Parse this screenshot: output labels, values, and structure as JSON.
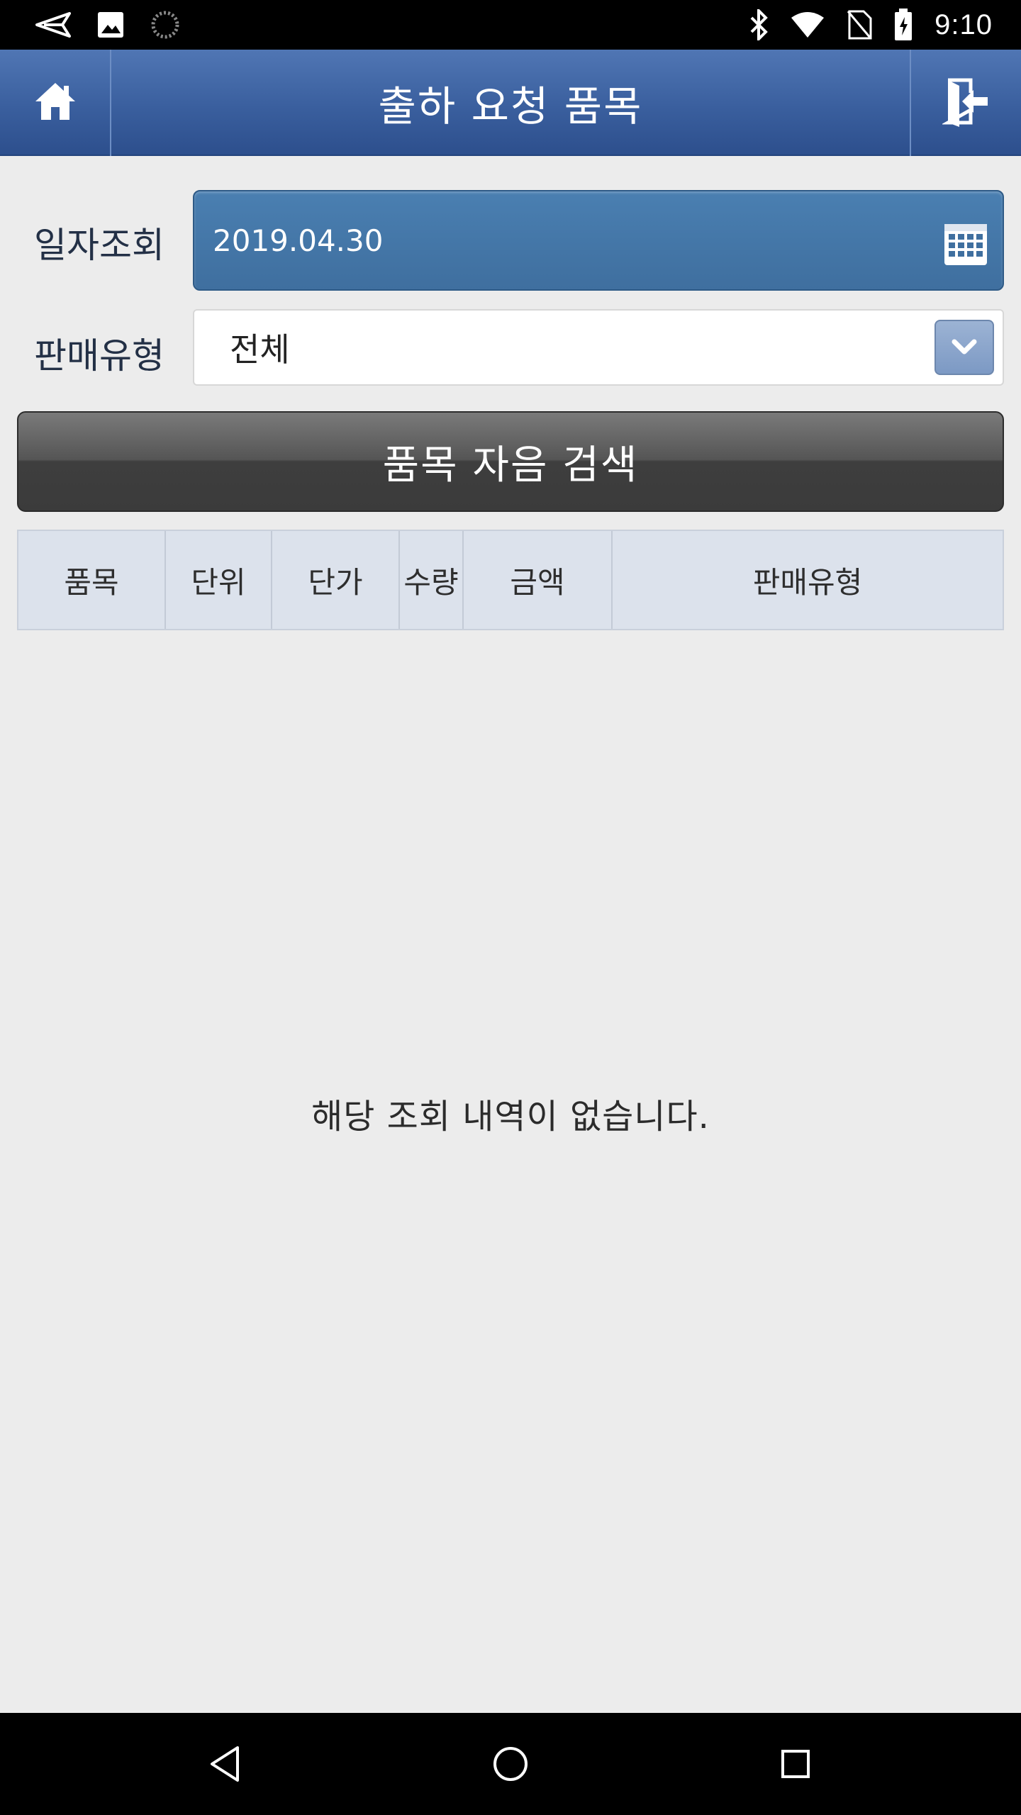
{
  "status_bar": {
    "time": "9:10",
    "icons": [
      "send-icon",
      "image-icon",
      "loading-icon",
      "bluetooth-icon",
      "wifi-icon",
      "no-sim-icon",
      "battery-icon"
    ]
  },
  "header": {
    "title": "출하 요청 품목",
    "home_icon": "home-icon",
    "exit_icon": "logout-icon"
  },
  "form": {
    "date_label": "일자조회",
    "date_value": "2019.04.30",
    "sales_type_label": "판매유형",
    "sales_type_value": "전체"
  },
  "search_button": {
    "label": "품목 자음 검색"
  },
  "table": {
    "columns": [
      "품목",
      "단위",
      "단가",
      "수량",
      "금액",
      "판매유형"
    ]
  },
  "empty_message": "해당 조회 내역이 없습니다.",
  "colors": {
    "header": "#3a5f9e",
    "date_field": "#4479aa",
    "search_button": "#4a4a4a",
    "table_header": "#dce2ec",
    "background": "#ececec"
  }
}
